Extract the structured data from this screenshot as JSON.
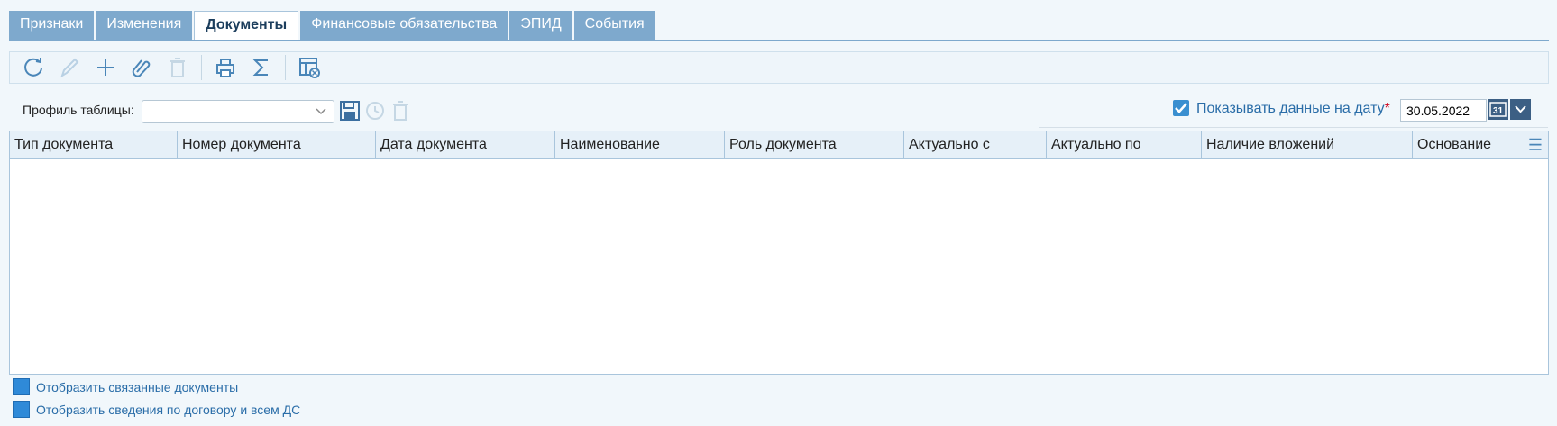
{
  "tabs": [
    {
      "label": "Признаки"
    },
    {
      "label": "Изменения"
    },
    {
      "label": "Документы"
    },
    {
      "label": "Финансовые обязательства"
    },
    {
      "label": "ЭПИД"
    },
    {
      "label": "События"
    }
  ],
  "profile": {
    "label": "Профиль таблицы:",
    "value": ""
  },
  "date_filter": {
    "label": "Показывать данные на дату",
    "required_mark": "*",
    "value": "30.05.2022",
    "checked": true,
    "calendar_text": "31"
  },
  "grid": {
    "columns": [
      "Тип документа",
      "Номер документа",
      "Дата документа",
      "Наименование",
      "Роль документа",
      "Актуально с",
      "Актуально по",
      "Наличие вложений",
      "Основание"
    ]
  },
  "links": {
    "related": "Отобразить связанные документы",
    "contract": "Отобразить сведения по договору и всем ДС"
  },
  "icons": [
    "refresh-icon",
    "edit-icon",
    "add-icon",
    "attach-icon",
    "delete-icon",
    "print-icon",
    "sum-icon",
    "table-settings-icon"
  ],
  "colors": {
    "tab": "#7ea9cd",
    "accent": "#2a6da8",
    "header_bg": "#e6f0f8"
  }
}
